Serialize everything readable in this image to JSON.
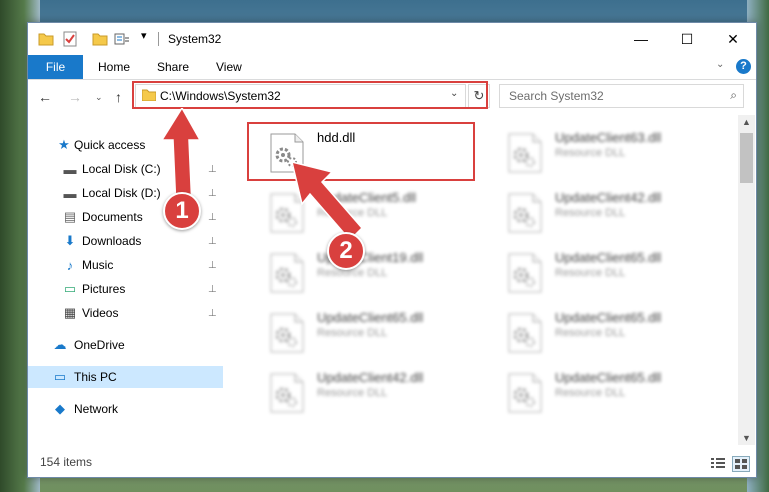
{
  "window": {
    "title": "System32"
  },
  "ribbon": {
    "tabs": [
      "File",
      "Home",
      "Share",
      "View"
    ],
    "help": "?"
  },
  "nav": {
    "back": "←",
    "forward": "→",
    "recent": "⌄",
    "up": "↑",
    "address": "C:\\Windows\\System32",
    "search_placeholder": "Search System32"
  },
  "sidebar": {
    "items": [
      {
        "label": "Quick access",
        "icon": "star-icon",
        "glyph": "★",
        "pinned": false
      },
      {
        "label": "Local Disk (C:)",
        "icon": "drive-icon",
        "glyph": "▬",
        "pinned": true
      },
      {
        "label": "Local Disk (D:)",
        "icon": "drive-icon",
        "glyph": "▬",
        "pinned": true
      },
      {
        "label": "Documents",
        "icon": "documents-icon",
        "glyph": "▤",
        "pinned": true
      },
      {
        "label": "Downloads",
        "icon": "downloads-icon",
        "glyph": "⬇",
        "pinned": true
      },
      {
        "label": "Music",
        "icon": "music-icon",
        "glyph": "♪",
        "pinned": true
      },
      {
        "label": "Pictures",
        "icon": "pictures-icon",
        "glyph": "▭",
        "pinned": true
      },
      {
        "label": "Videos",
        "icon": "videos-icon",
        "glyph": "▦",
        "pinned": true
      },
      {
        "label": "OneDrive",
        "icon": "onedrive-icon",
        "glyph": "☁",
        "pinned": false
      },
      {
        "label": "This PC",
        "icon": "this-pc-icon",
        "glyph": "▭",
        "pinned": false
      },
      {
        "label": "Network",
        "icon": "network-icon",
        "glyph": "◆",
        "pinned": false
      }
    ]
  },
  "files": [
    {
      "name": "hdd.dll",
      "type": ""
    },
    {
      "name": "UpdateClient63.dll",
      "type": "Resource DLL"
    },
    {
      "name": "UpdateClient5.dll",
      "type": "Resource DLL"
    },
    {
      "name": "UpdateClient42.dll",
      "type": "Resource DLL"
    },
    {
      "name": "UpdateClient19.dll",
      "type": "Resource DLL"
    },
    {
      "name": "UpdateClient65.dll",
      "type": "Resource DLL"
    },
    {
      "name": "UpdateClient65.dll",
      "type": "Resource DLL"
    },
    {
      "name": "UpdateClient65.dll",
      "type": "Resource DLL"
    },
    {
      "name": "UpdateClient42.dll",
      "type": "Resource DLL"
    },
    {
      "name": "UpdateClient65.dll",
      "type": "Resource DLL"
    }
  ],
  "status": {
    "item_count": "154 items"
  },
  "annotations": {
    "step1": "1",
    "step2": "2"
  },
  "colors": {
    "accent": "#1979ca",
    "highlight": "#d9403e",
    "selected": "#cce8ff"
  }
}
